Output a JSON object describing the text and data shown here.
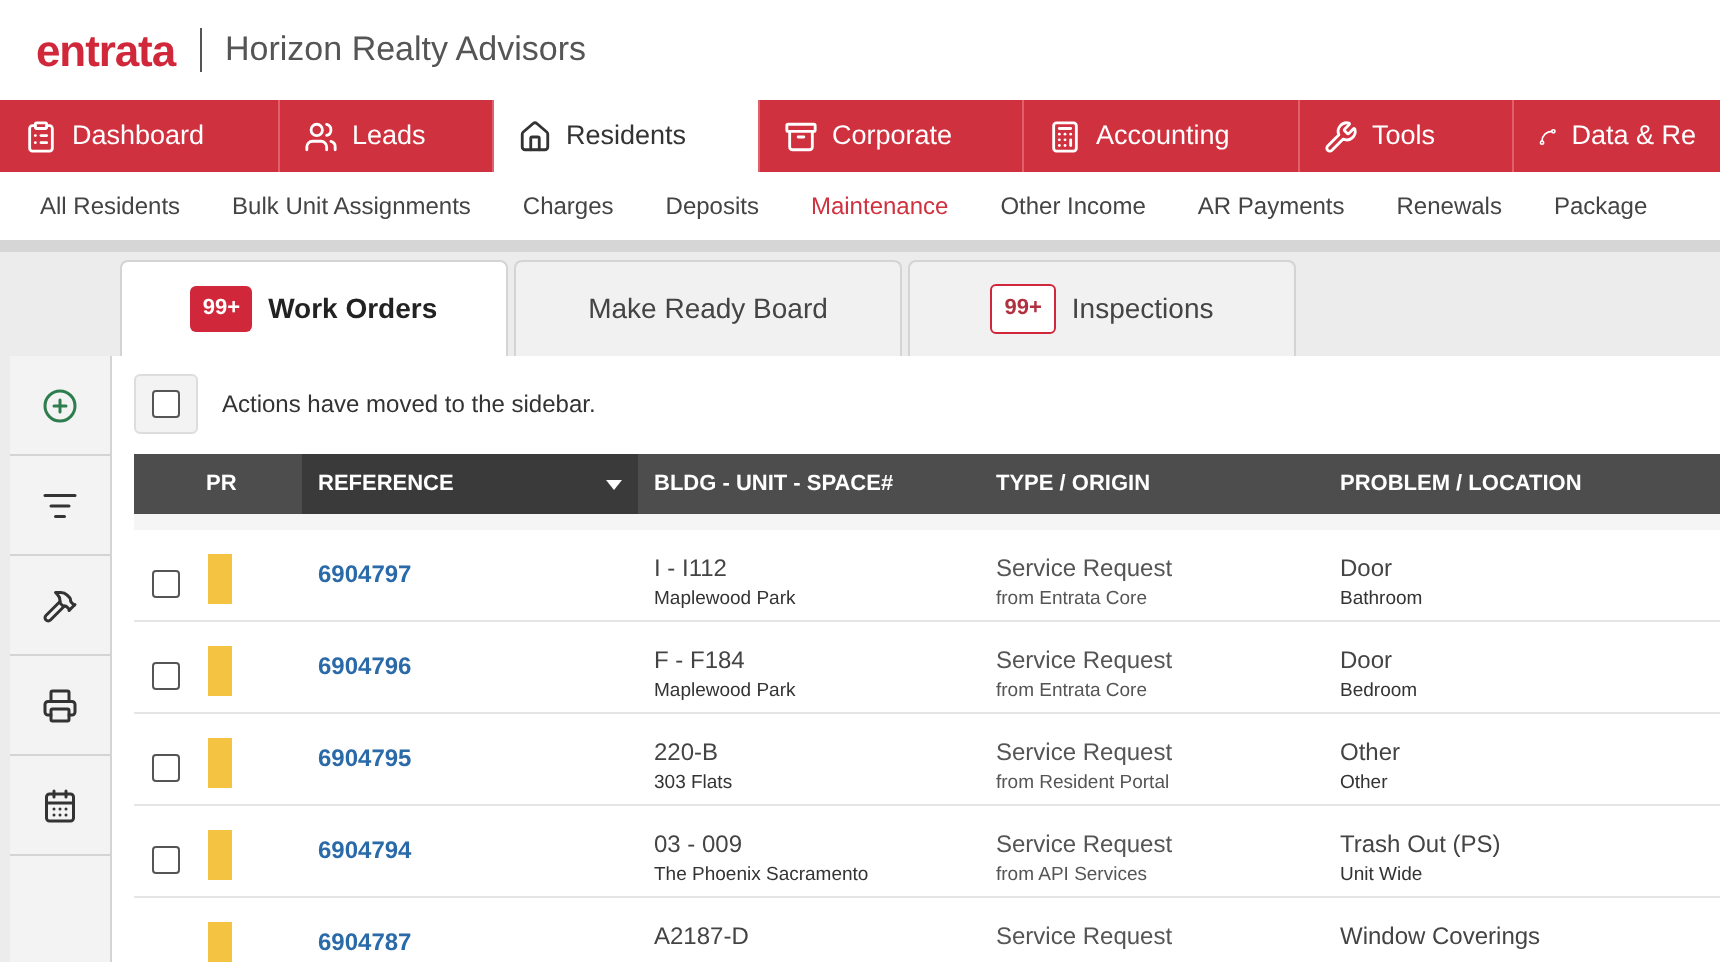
{
  "header": {
    "logo": "entrata",
    "company": "Horizon Realty Advisors"
  },
  "main_nav": [
    {
      "label": "Dashboard",
      "selected": false
    },
    {
      "label": "Leads",
      "selected": false
    },
    {
      "label": "Residents",
      "selected": true
    },
    {
      "label": "Corporate",
      "selected": false
    },
    {
      "label": "Accounting",
      "selected": false
    },
    {
      "label": "Tools",
      "selected": false
    },
    {
      "label": "Data & Re",
      "selected": false
    }
  ],
  "sub_nav": [
    {
      "label": "All Residents",
      "selected": false
    },
    {
      "label": "Bulk Unit Assignments",
      "selected": false
    },
    {
      "label": "Charges",
      "selected": false
    },
    {
      "label": "Deposits",
      "selected": false
    },
    {
      "label": "Maintenance",
      "selected": true
    },
    {
      "label": "Other Income",
      "selected": false
    },
    {
      "label": "AR Payments",
      "selected": false
    },
    {
      "label": "Renewals",
      "selected": false
    },
    {
      "label": "Package",
      "selected": false
    }
  ],
  "tabs": [
    {
      "label": "Work Orders",
      "badge": "99+",
      "selected": true
    },
    {
      "label": "Make Ready Board",
      "selected": false
    },
    {
      "label": "Inspections",
      "badge": "99+",
      "selected": false
    }
  ],
  "actions_notice": {
    "checked": false,
    "text": "Actions have moved to the sidebar."
  },
  "table": {
    "columns": [
      {
        "label": "PR",
        "sorted": false
      },
      {
        "label": "REFERENCE",
        "sorted": true
      },
      {
        "label": "BLDG - UNIT - SPACE#",
        "sorted": false
      },
      {
        "label": "TYPE / ORIGIN",
        "sorted": false
      },
      {
        "label": "PROBLEM / LOCATION",
        "sorted": false
      }
    ],
    "rows": [
      {
        "checked": false,
        "color": "#f5c342",
        "reference": "6904797",
        "unit": "I - I112",
        "property": "Maplewood Park",
        "type": "Service Request",
        "origin": "from Entrata Core",
        "problem": "Door",
        "location": "Bathroom"
      },
      {
        "checked": false,
        "color": "#f5c342",
        "reference": "6904796",
        "unit": "F - F184",
        "property": "Maplewood Park",
        "type": "Service Request",
        "origin": "from Entrata Core",
        "problem": "Door",
        "location": "Bedroom"
      },
      {
        "checked": false,
        "color": "#f5c342",
        "reference": "6904795",
        "unit": "220-B",
        "property": "303 Flats",
        "type": "Service Request",
        "origin": "from Resident Portal",
        "problem": "Other",
        "location": "Other"
      },
      {
        "checked": false,
        "color": "#f5c342",
        "reference": "6904794",
        "unit": "03 - 009",
        "property": "The Phoenix Sacramento",
        "type": "Service Request",
        "origin": "from API Services",
        "problem": "Trash Out (PS)",
        "location": "Unit Wide"
      },
      {
        "color": "#f5c342",
        "reference": "6904787",
        "unit": "A2187-D",
        "type": "Service Request",
        "problem": "Window Coverings"
      }
    ]
  }
}
